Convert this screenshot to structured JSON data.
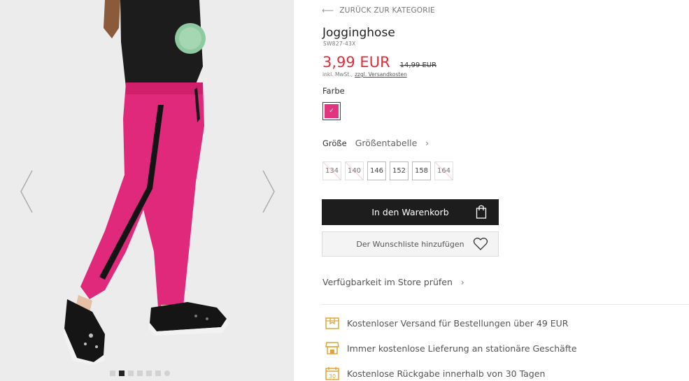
{
  "gallery": {
    "prev_icon": "chevron-left-icon",
    "next_icon": "chevron-right-icon",
    "dots": [
      {
        "active": false,
        "round": false
      },
      {
        "active": true,
        "round": false
      },
      {
        "active": false,
        "round": false
      },
      {
        "active": false,
        "round": false
      },
      {
        "active": false,
        "round": false
      },
      {
        "active": false,
        "round": false
      },
      {
        "active": false,
        "round": true
      }
    ]
  },
  "navigation": {
    "back_label": "ZURÜCK ZUR KATEGORIE"
  },
  "product": {
    "name": "Jogginghose",
    "sku": "SW827-43X",
    "price": "3,99 EUR",
    "old_price": "14,99 EUR",
    "tax_note": "inkl. MwSt.,",
    "shipping_link": "zzgl. Versandkosten",
    "color_label": "Farbe",
    "selected_color": "#e3347f",
    "size_label": "Größe",
    "size_chart_label": "Größentabelle",
    "sizes": [
      {
        "label": "134",
        "available": false
      },
      {
        "label": "140",
        "available": false
      },
      {
        "label": "146",
        "available": true
      },
      {
        "label": "152",
        "available": true
      },
      {
        "label": "158",
        "available": true
      },
      {
        "label": "164",
        "available": false
      }
    ]
  },
  "actions": {
    "add_to_cart": "In den Warenkorb",
    "wishlist": "Der Wunschliste hinzufügen",
    "store_availability": "Verfügbarkeit im Store prüfen"
  },
  "features": [
    {
      "icon": "truck-icon",
      "text": "Kostenloser Versand für Bestellungen über 49 EUR"
    },
    {
      "icon": "store-icon",
      "text": "Immer kostenlose Lieferung an stationäre Geschäfte"
    },
    {
      "icon": "calendar-30-icon",
      "text": "Kostenlose Rückgabe innerhalb von 30 Tagen",
      "badge": "30"
    }
  ],
  "colors": {
    "price_red": "#e12c3c",
    "button_dark": "#1d1d1d",
    "icon_gold": "#e0a53a"
  }
}
